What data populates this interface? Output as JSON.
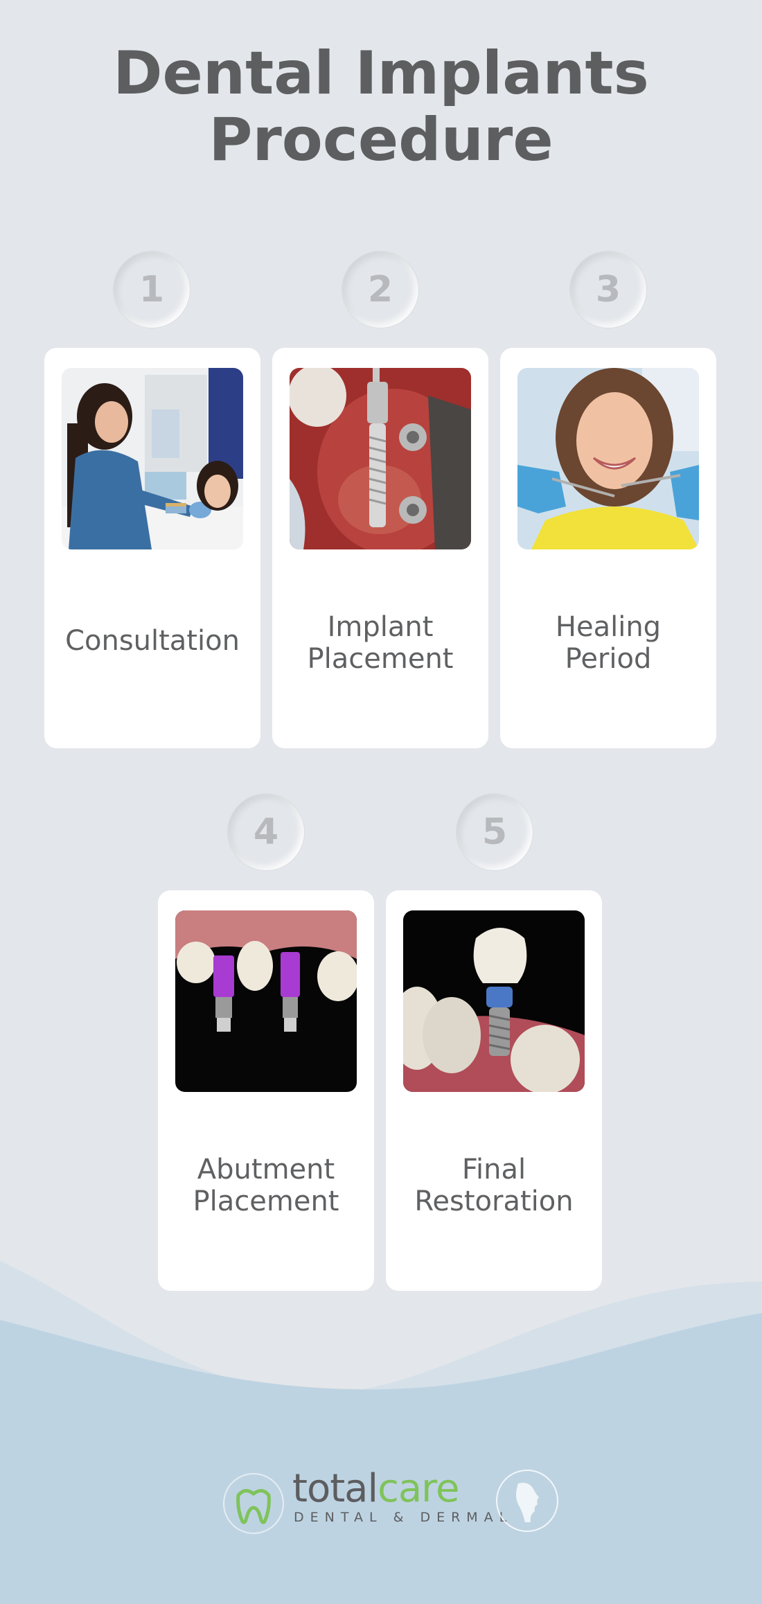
{
  "header": {
    "title_line1": "Dental Implants",
    "title_line2": "Procedure"
  },
  "steps": [
    {
      "number": "1",
      "label_line1": "Consultation",
      "label_line2": "",
      "image": "dentist-consultation-photo"
    },
    {
      "number": "2",
      "label_line1": "Implant",
      "label_line2": "Placement",
      "image": "implant-in-gum-photo"
    },
    {
      "number": "3",
      "label_line1": "Healing",
      "label_line2": "Period",
      "image": "smiling-patient-photo"
    },
    {
      "number": "4",
      "label_line1": "Abutment",
      "label_line2": "Placement",
      "image": "abutments-on-implants-photo"
    },
    {
      "number": "5",
      "label_line1": "Final",
      "label_line2": "Restoration",
      "image": "crown-on-implant-render"
    }
  ],
  "footer": {
    "brand_part1": "total",
    "brand_part2": "care",
    "tagline": "DENTAL & DERMAL",
    "icons": [
      "tooth-icon",
      "face-profile-icon"
    ]
  },
  "colors": {
    "background": "#e3e6ea",
    "title": "#5d5e60",
    "card": "#ffffff",
    "number": "#b7b9bc",
    "wave_light": "#d3dfe8",
    "wave_dark": "#bcd3e2",
    "brand_green": "#7fc35a"
  }
}
